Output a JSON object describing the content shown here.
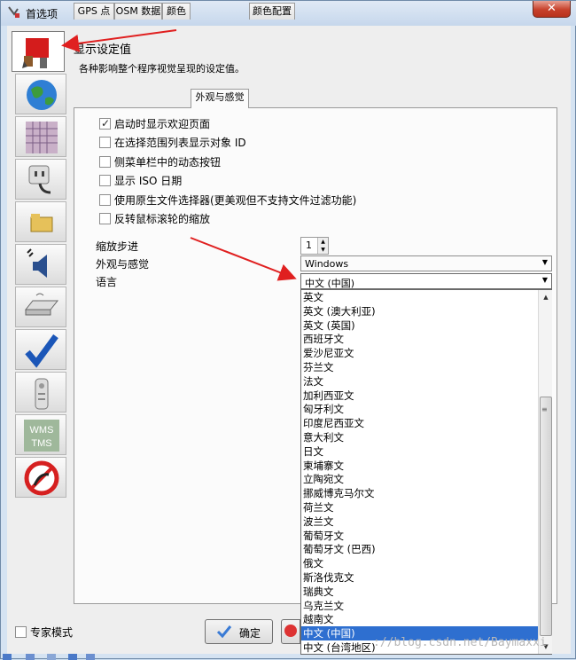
{
  "window": {
    "title": "首选项",
    "close_label": "✕"
  },
  "header": {
    "title": "显示设定值",
    "description": "各种影响整个程序视觉呈现的设定值。"
  },
  "sidebar": {
    "items": [
      {
        "name": "display-settings",
        "icon": "paint-brush-icon"
      },
      {
        "name": "map-projection",
        "icon": "globe-icon"
      },
      {
        "name": "grid",
        "icon": "grid-icon"
      },
      {
        "name": "connection",
        "icon": "plug-icon"
      },
      {
        "name": "plugins",
        "icon": "folder-icon"
      },
      {
        "name": "audio",
        "icon": "speaker-icon"
      },
      {
        "name": "shortcuts",
        "icon": "keyboard-icon"
      },
      {
        "name": "validator",
        "icon": "checkmark-icon"
      },
      {
        "name": "remote-control",
        "icon": "remote-icon"
      },
      {
        "name": "imagery",
        "icon": "wms-tms-icon",
        "label": "WMS\nTMS"
      },
      {
        "name": "no-entry",
        "icon": "prohibited-icon"
      }
    ]
  },
  "tabs": [
    {
      "label": "GPS 点"
    },
    {
      "label": "OSM 数据"
    },
    {
      "label": "颜色"
    },
    {
      "label": "外观与感觉"
    },
    {
      "label": "颜色配置"
    }
  ],
  "options": [
    {
      "label": "启动时显示欢迎页面",
      "checked": true
    },
    {
      "label": "在选择范围列表显示对象 ID",
      "checked": false
    },
    {
      "label": "侧菜单栏中的动态按钮",
      "checked": false
    },
    {
      "label": "显示 ISO 日期",
      "checked": false
    },
    {
      "label": "使用原生文件选择器(更美观但不支持文件过滤功能)",
      "checked": false
    },
    {
      "label": "反转鼠标滚轮的缩放",
      "checked": false
    }
  ],
  "zoom_step": {
    "label": "缩放步进",
    "value": "1"
  },
  "look_and_feel": {
    "label": "外观与感觉",
    "value": "Windows"
  },
  "language": {
    "label": "语言",
    "value": "中文 (中国)",
    "options": [
      "英文",
      "英文 (澳大利亚)",
      "英文 (英国)",
      "西班牙文",
      "爱沙尼亚文",
      "芬兰文",
      "法文",
      "加利西亚文",
      "匈牙利文",
      "印度尼西亚文",
      "意大利文",
      "日文",
      "柬埔寨文",
      "立陶宛文",
      "挪威博克马尔文",
      "荷兰文",
      "波兰文",
      "葡萄牙文",
      "葡萄牙文 (巴西)",
      "俄文",
      "斯洛伐克文",
      "瑞典文",
      "乌克兰文",
      "越南文",
      "中文 (中国)",
      "中文 (台湾地区)"
    ],
    "selected_index": 24
  },
  "footer": {
    "expert_mode_label": "专家模式",
    "ok_label": "确定"
  },
  "watermark": "://blog.csdn.net/Baymaxxi",
  "colors": {
    "selection": "#2e6fd0",
    "arrow": "#e02020"
  }
}
